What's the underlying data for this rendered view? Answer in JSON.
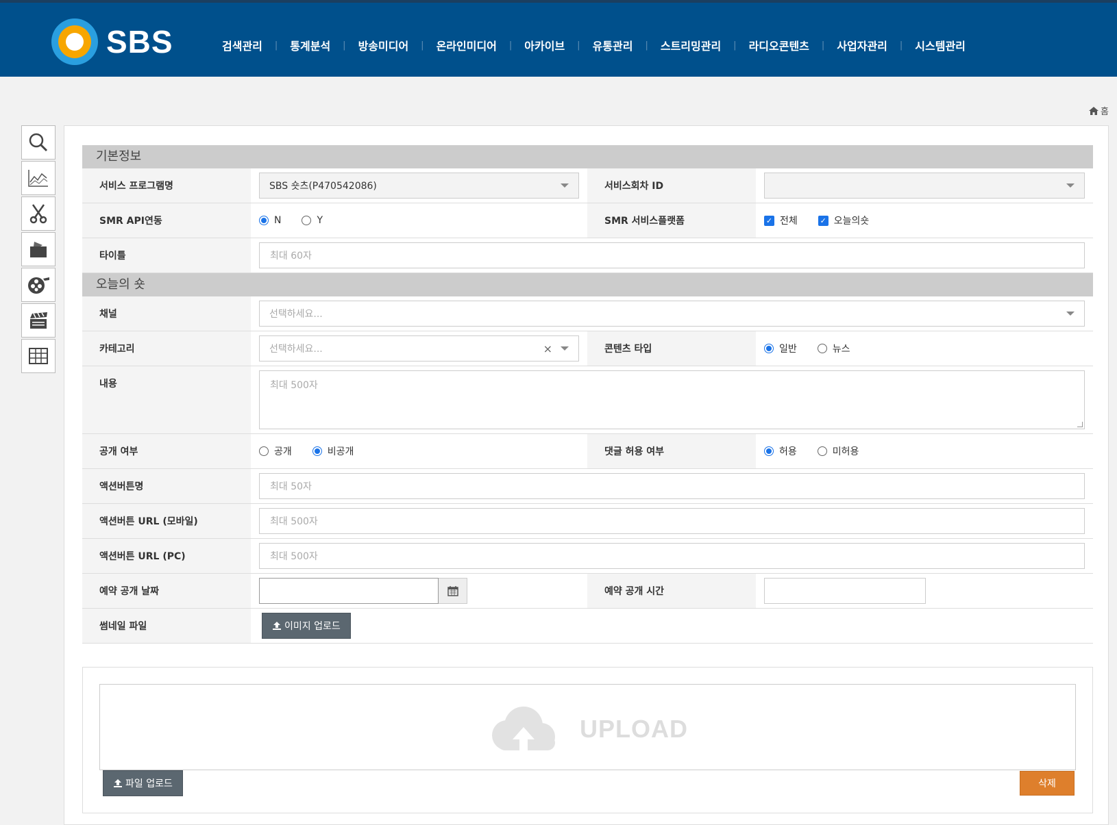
{
  "brand": {
    "logo_text": "SBS"
  },
  "nav": [
    "검색관리",
    "통계분석",
    "방송미디어",
    "온라인미디어",
    "아카이브",
    "유통관리",
    "스트리밍관리",
    "라디오콘텐츠",
    "사업자관리",
    "시스템관리"
  ],
  "breadcrumb": {
    "home": "홈"
  },
  "side_tools": [
    "search-icon",
    "chart-icon",
    "scissors-icon",
    "folder-icon",
    "film-reel-icon",
    "clapperboard-icon",
    "table-icon"
  ],
  "form": {
    "basic_section": "기본정보",
    "program_label": "서비스 프로그램명",
    "program_value": "SBS 숏츠(P470542086)",
    "episode_label": "서비스회차 ID",
    "episode_value": "",
    "smr_api_label": "SMR API연동",
    "smr_api_n": "N",
    "smr_api_y": "Y",
    "smr_platform_label": "SMR 서비스플랫폼",
    "platform_all": "전체",
    "platform_today": "오늘의숏",
    "title_label": "타이틀",
    "title_placeholder": "최대 60자",
    "today_section": "오늘의 숏",
    "channel_label": "채널",
    "channel_placeholder": "선택하세요...",
    "category_label": "카테고리",
    "category_placeholder": "선택하세요...",
    "content_type_label": "콘텐츠 타입",
    "content_type_normal": "일반",
    "content_type_news": "뉴스",
    "body_label": "내용",
    "body_placeholder": "최대 500자",
    "public_label": "공개 여부",
    "public_yes": "공개",
    "public_no": "비공개",
    "comment_label": "댓글 허용 여부",
    "comment_allow": "허용",
    "comment_deny": "미허용",
    "action_name_label": "액션버튼명",
    "action_name_placeholder": "최대 50자",
    "action_url_mobile_label": "액션버튼 URL (모바일)",
    "action_url_mobile_placeholder": "최대 500자",
    "action_url_pc_label": "액션버튼 URL (PC)",
    "action_url_pc_placeholder": "최대 500자",
    "reserve_date_label": "예약 공개 날짜",
    "reserve_time_label": "예약 공개 시간",
    "thumb_label": "썸네일 파일",
    "image_upload_btn": "이미지 업로드"
  },
  "upload": {
    "drop_label": "UPLOAD",
    "file_upload_btn": "파일 업로드",
    "delete_btn": "삭제"
  },
  "colors": {
    "header": "#00508c",
    "accent": "#1a73e8",
    "delete": "#de7f2c"
  }
}
